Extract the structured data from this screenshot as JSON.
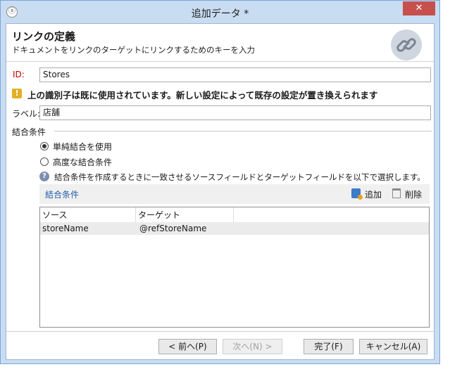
{
  "window": {
    "title": "追加データ *",
    "close_label": "✕"
  },
  "header": {
    "title": "リンクの定義",
    "subtitle": "ドキュメントをリンクのターゲットにリンクするためのキーを入力"
  },
  "id_field": {
    "label": "ID:",
    "value": "Stores"
  },
  "warning": {
    "text": "上の識別子は既に使用されています。新しい設定によって既存の設定が置き換えられます"
  },
  "label_field": {
    "label": "ラベル:",
    "value": "店舗"
  },
  "join": {
    "group_label": "結合条件",
    "option_simple": "単純結合を使用",
    "option_advanced": "高度な結合条件",
    "selected": "simple",
    "help_text": "結合条件を作成するときに一致させるソースフィールドとターゲットフィールドを以下で選択します。"
  },
  "toolbar": {
    "title": "結合条件",
    "add_label": "追加",
    "delete_label": "削除"
  },
  "grid": {
    "columns": [
      "ソース",
      "ターゲット"
    ],
    "rows": [
      {
        "source": "storeName",
        "target": "@refStoreName"
      }
    ]
  },
  "buttons": {
    "back": "< 前へ(P)",
    "next": "次へ(N) >",
    "finish": "完了(F)",
    "cancel": "キャンセル(A)"
  },
  "colors": {
    "error_label": "#c00000",
    "link_blue": "#2460a7",
    "warning": "#e2b024"
  }
}
